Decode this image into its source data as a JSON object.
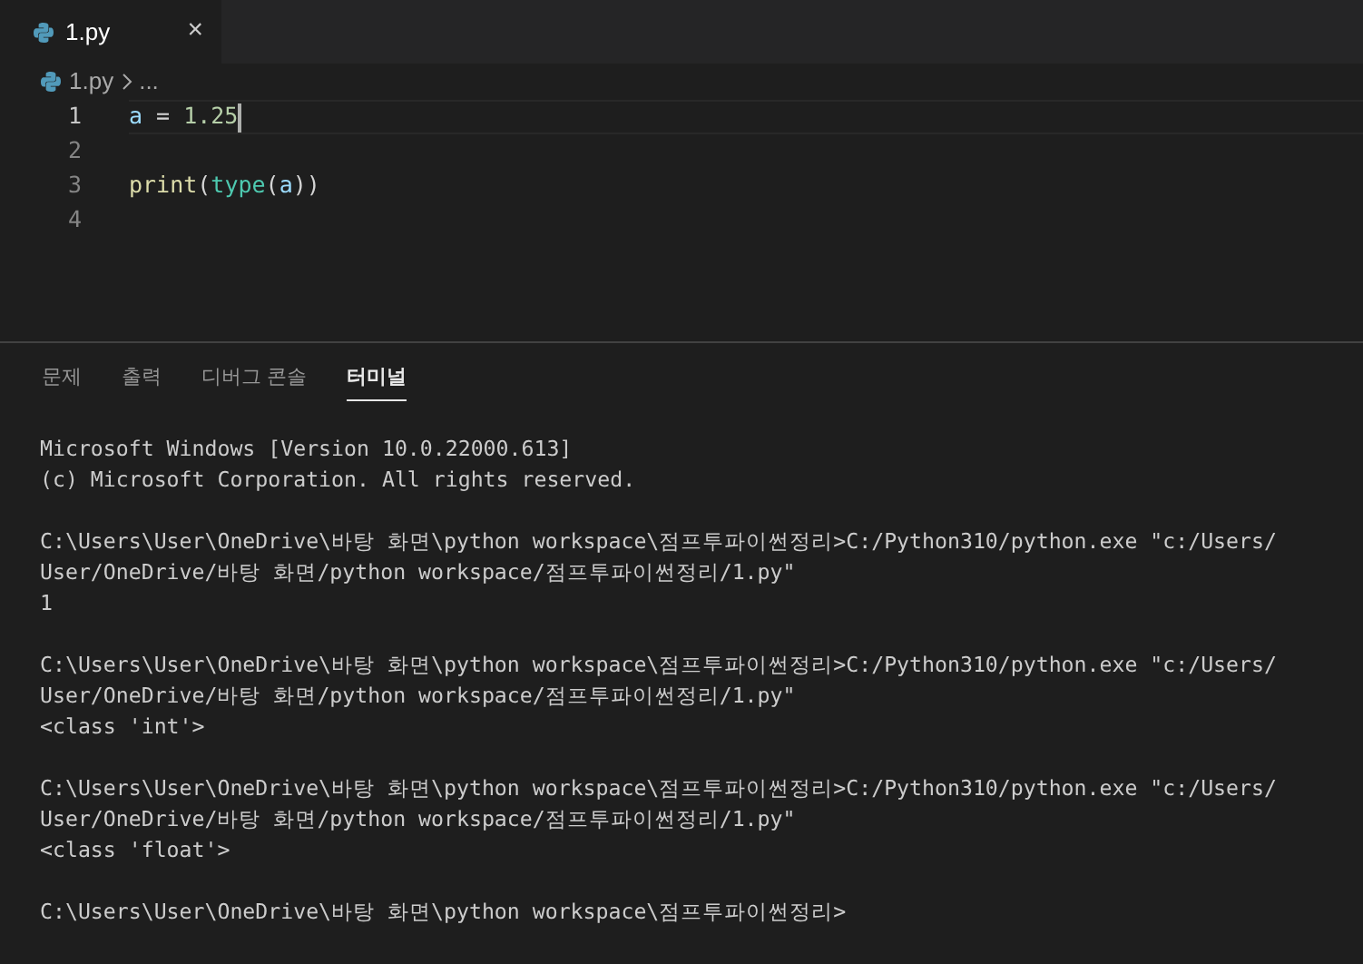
{
  "tabs": [
    {
      "label": "1.py",
      "close": "×",
      "selected": true
    }
  ],
  "breadcrumb": {
    "file": "1.py",
    "rest": "..."
  },
  "editor": {
    "lines": [
      {
        "number": "1",
        "current": true,
        "tokens": [
          {
            "kind": "variable",
            "text": "a"
          },
          {
            "kind": "plain",
            "text": " = "
          },
          {
            "kind": "number",
            "text": "1.25"
          }
        ]
      },
      {
        "number": "2",
        "current": false
      },
      {
        "number": "3",
        "current": false,
        "tokens": [
          {
            "kind": "function",
            "text": "print"
          },
          {
            "kind": "plain",
            "text": "("
          },
          {
            "kind": "class",
            "text": "type"
          },
          {
            "kind": "plain",
            "text": "("
          },
          {
            "kind": "variable",
            "text": "a"
          },
          {
            "kind": "plain",
            "text": "))"
          }
        ]
      },
      {
        "number": "4",
        "current": false
      }
    ]
  },
  "panel_tabs": [
    {
      "label": "문제",
      "selected": false
    },
    {
      "label": "출력",
      "selected": false
    },
    {
      "label": "디버그 콘솔",
      "selected": false
    },
    {
      "label": "터미널",
      "selected": true
    }
  ],
  "terminal": [
    [
      "Microsoft Windows [Version 10.0.22000.613]",
      "(c) Microsoft Corporation. All rights reserved."
    ],
    [
      "C:\\Users\\User\\OneDrive\\바탕 화면\\python workspace\\점프투파이썬정리>C:/Python310/python.exe \"c:/Users/",
      "User/OneDrive/바탕 화면/python workspace/점프투파이썬정리/1.py\"",
      "1"
    ],
    [
      "C:\\Users\\User\\OneDrive\\바탕 화면\\python workspace\\점프투파이썬정리>C:/Python310/python.exe \"c:/Users/",
      "User/OneDrive/바탕 화면/python workspace/점프투파이썬정리/1.py\"",
      "<class 'int'>"
    ],
    [
      "C:\\Users\\User\\OneDrive\\바탕 화면\\python workspace\\점프투파이썬정리>C:/Python310/python.exe \"c:/Users/",
      "User/OneDrive/바탕 화면/python workspace/점프투파이썬정리/1.py\"",
      "<class 'float'>"
    ],
    [
      "C:\\Users\\User\\OneDrive\\바탕 화면\\python workspace\\점프투파이썬정리>"
    ]
  ]
}
